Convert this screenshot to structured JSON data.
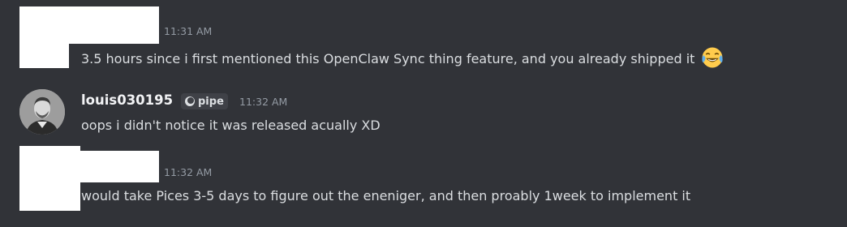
{
  "colors": {
    "background": "#313338",
    "text": "#dbdee1",
    "username": "#f2f3f5",
    "timestamp": "#949ba4",
    "badge_bg": "#3f4147"
  },
  "messages": [
    {
      "author": "",
      "author_redacted": true,
      "timestamp": "11:31 AM",
      "text": "3.5 hours since i first mentioned this OpenClaw Sync thing feature, and you already shipped it",
      "emoji": "joy-emoji"
    },
    {
      "author": "louis030195",
      "server_tag": "pipe",
      "server_tag_icon": "pipe-tag-icon",
      "timestamp": "11:32 AM",
      "text": "oops i didn't notice it was released acually XD"
    },
    {
      "author": "",
      "author_redacted": true,
      "timestamp": "11:32 AM",
      "text": "would take Pices 3-5 days to figure out the eneniger, and then proably 1week to implement it"
    }
  ]
}
